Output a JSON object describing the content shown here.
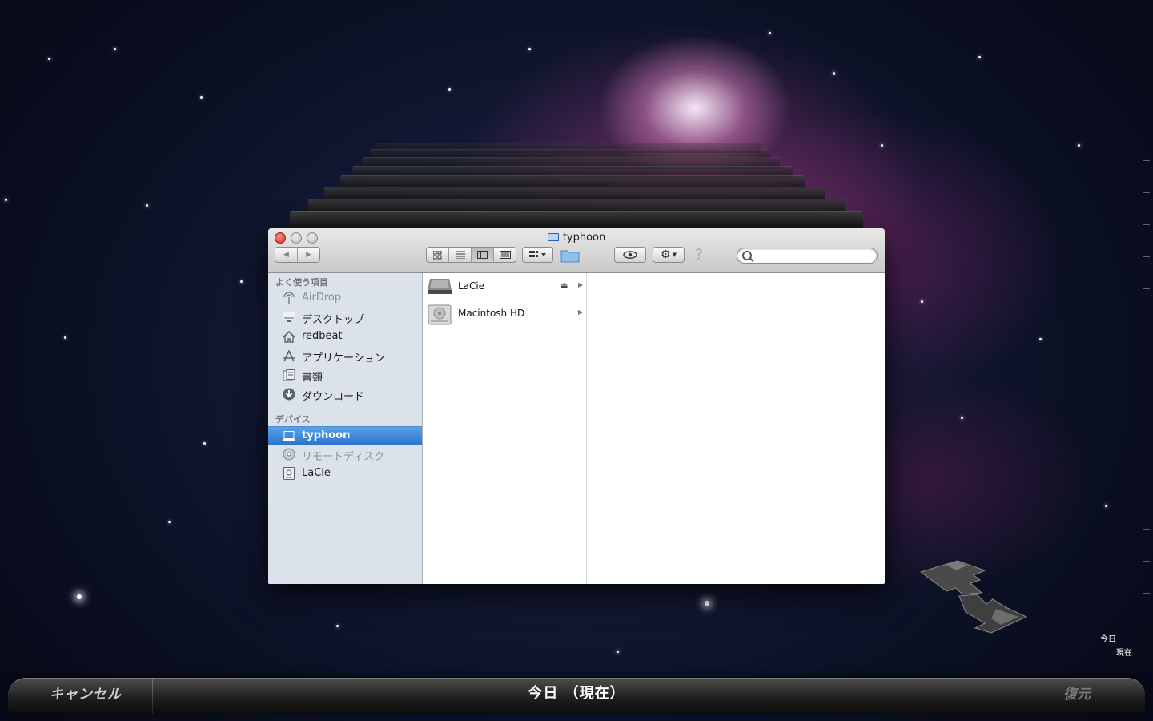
{
  "window": {
    "title": "typhoon",
    "search_placeholder": ""
  },
  "toolbar": {
    "back_label": "◀",
    "forward_label": "▶",
    "help_label": "?"
  },
  "sidebar": {
    "favorites_header": "よく使う項目",
    "favorites": [
      {
        "label": "AirDrop",
        "icon": "airdrop-icon",
        "dim": true
      },
      {
        "label": "デスクトップ",
        "icon": "desktop-icon"
      },
      {
        "label": "redbeat",
        "icon": "home-icon"
      },
      {
        "label": "アプリケーション",
        "icon": "applications-icon"
      },
      {
        "label": "書類",
        "icon": "documents-icon"
      },
      {
        "label": "ダウンロード",
        "icon": "downloads-icon"
      }
    ],
    "devices_header": "デバイス",
    "devices": [
      {
        "label": "typhoon",
        "icon": "laptop-icon",
        "selected": true
      },
      {
        "label": "リモートディスク",
        "icon": "remote-disc-icon",
        "dim": true
      },
      {
        "label": "LaCie",
        "icon": "external-drive-icon"
      }
    ]
  },
  "column": {
    "items": [
      {
        "name": "LaCie",
        "icon": "external-drive-icon",
        "ejectable": true
      },
      {
        "name": "Macintosh HD",
        "icon": "hard-drive-icon",
        "ejectable": false
      }
    ]
  },
  "bottom_bar": {
    "cancel_label": "キャンセル",
    "date_label": "今日 （現在）",
    "restore_label": "復元"
  },
  "timeline": {
    "today_label": "今日",
    "now_label": "現在"
  },
  "colors": {
    "selection": "#2c75cf",
    "sidebar_bg": "#dce2ea"
  }
}
